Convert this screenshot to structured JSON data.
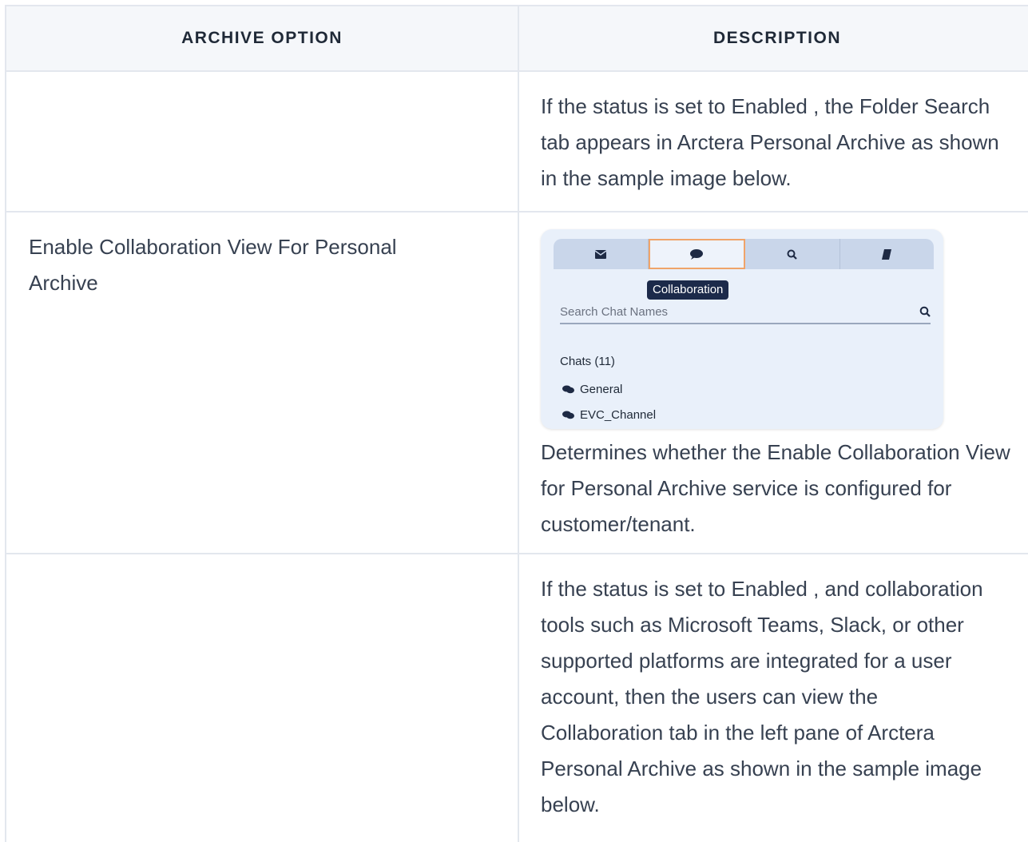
{
  "table": {
    "headers": {
      "option": "ARCHIVE OPTION",
      "description": "DESCRIPTION"
    },
    "rows": [
      {
        "option": "",
        "description": "If the status is set to Enabled , the Folder Search tab appears in Arctera Personal Archive as shown in the sample image below."
      },
      {
        "option": "Enable Collaboration View For Personal Archive",
        "description": "Determines whether the Enable Collaboration View for Personal Archive service is configured for customer/tenant.",
        "sample_image": {
          "tabs": [
            {
              "icon": "envelope-icon",
              "active": false
            },
            {
              "icon": "chat-bubble-icon",
              "active": true
            },
            {
              "icon": "search-icon",
              "active": false
            },
            {
              "icon": "book-icon",
              "active": false
            }
          ],
          "tooltip": "Collaboration",
          "search_placeholder": "Search Chat Names",
          "chats_title": "Chats (11)",
          "chats": [
            "General",
            "EVC_Channel"
          ],
          "colors": {
            "active_tab_border": "#f0a46a",
            "tooltip_bg": "#1c2a4a",
            "tabbar_bg": "#c9d6ea"
          }
        }
      },
      {
        "option": "",
        "description": "If the status is set to Enabled , and collaboration tools such as Microsoft Teams, Slack, or other supported platforms are integrated for a user account, then the users can view the Collaboration tab in the left pane of Arctera Personal Archive as shown in the sample image below."
      }
    ]
  }
}
